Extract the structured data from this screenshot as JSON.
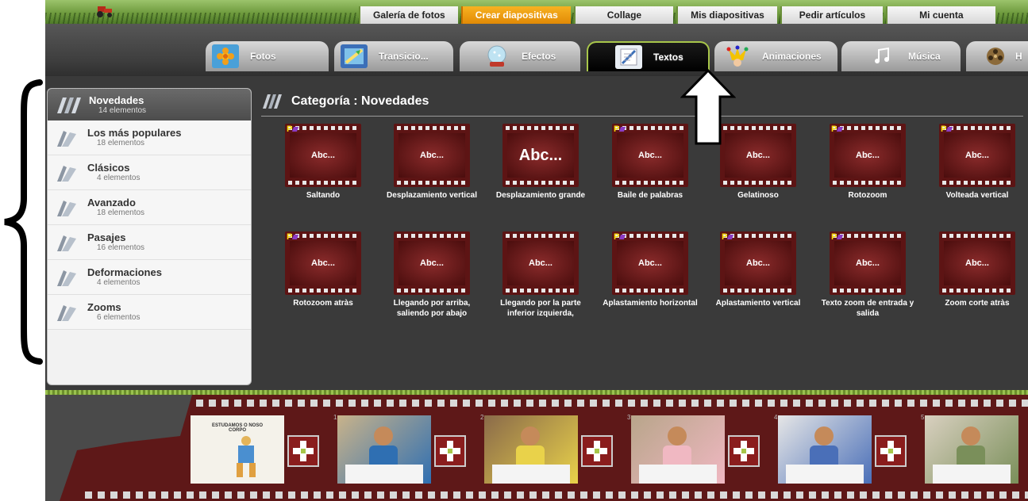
{
  "top_menu": [
    {
      "label": "Galería de fotos",
      "active": false
    },
    {
      "label": "Crear diapositivas",
      "active": true
    },
    {
      "label": "Collage",
      "active": false
    },
    {
      "label": "Mis diapositivas",
      "active": false
    },
    {
      "label": "Pedir artículos",
      "active": false
    },
    {
      "label": "Mi cuenta",
      "active": false
    }
  ],
  "tabs": [
    {
      "label": "Fotos",
      "icon": "photo-flower-icon",
      "active": false
    },
    {
      "label": "Transicio...",
      "icon": "transition-icon",
      "active": false
    },
    {
      "label": "Efectos",
      "icon": "snow-globe-icon",
      "active": false
    },
    {
      "label": "Textos",
      "icon": "pencil-paper-icon",
      "active": true
    },
    {
      "label": "Animaciones",
      "icon": "jester-icon",
      "active": false
    },
    {
      "label": "Música",
      "icon": "music-notes-icon",
      "active": false
    },
    {
      "label": "H",
      "icon": "film-reel-icon",
      "active": false
    }
  ],
  "sidebar": {
    "header": {
      "title": "Novedades",
      "count": "14 elementos"
    },
    "items": [
      {
        "title": "Los más populares",
        "count": "18 elementos"
      },
      {
        "title": "Clásicos",
        "count": "4 elementos"
      },
      {
        "title": "Avanzado",
        "count": "18 elementos"
      },
      {
        "title": "Pasajes",
        "count": "16 elementos"
      },
      {
        "title": "Deformaciones",
        "count": "4 elementos"
      },
      {
        "title": "Zooms",
        "count": "6 elementos"
      }
    ]
  },
  "category": {
    "title": "Categoría : Novedades"
  },
  "effects": [
    {
      "label": "Saltando",
      "premium": true,
      "preview": "Abc..."
    },
    {
      "label": "Desplazamiento vertical",
      "premium": false,
      "preview": "Abc..."
    },
    {
      "label": "Desplazamiento grande",
      "premium": false,
      "preview": "Abc..."
    },
    {
      "label": "Baile de palabras",
      "premium": true,
      "preview": "Abc..."
    },
    {
      "label": "Gelatinoso",
      "premium": false,
      "preview": "Abc..."
    },
    {
      "label": "Rotozoom",
      "premium": true,
      "preview": "Abc..."
    },
    {
      "label": "Volteada vertical",
      "premium": true,
      "preview": "Abc..."
    },
    {
      "label": "Rotozoom atràs",
      "premium": true,
      "preview": "Abc..."
    },
    {
      "label": "Llegando por arriba, saliendo por abajo",
      "premium": false,
      "preview": "Abc..."
    },
    {
      "label": "Llegando por la parte inferior izquierda,",
      "premium": false,
      "preview": "Abc..."
    },
    {
      "label": "Aplastamiento horizontal",
      "premium": true,
      "preview": "Abc..."
    },
    {
      "label": "Aplastamiento vertical",
      "premium": true,
      "preview": "Abc..."
    },
    {
      "label": "Texto zoom de entrada y salida",
      "premium": true,
      "preview": "Abc..."
    },
    {
      "label": "Zoom corte atràs",
      "premium": false,
      "preview": "Abc..."
    }
  ],
  "storyboard": {
    "slides": [
      {
        "number": "1",
        "caption": "ESTUDAMOS O NOSO CORPO"
      },
      {
        "number": "2",
        "caption": ""
      },
      {
        "number": "3",
        "caption": ""
      },
      {
        "number": "4",
        "caption": ""
      },
      {
        "number": "5",
        "caption": ""
      },
      {
        "number": "6",
        "caption": ""
      }
    ]
  },
  "colors": {
    "menu_active": "#f29a0f",
    "tab_active_border": "#a8c64a",
    "film_red": "#5d1414",
    "premium_badge": "#f6d400"
  }
}
